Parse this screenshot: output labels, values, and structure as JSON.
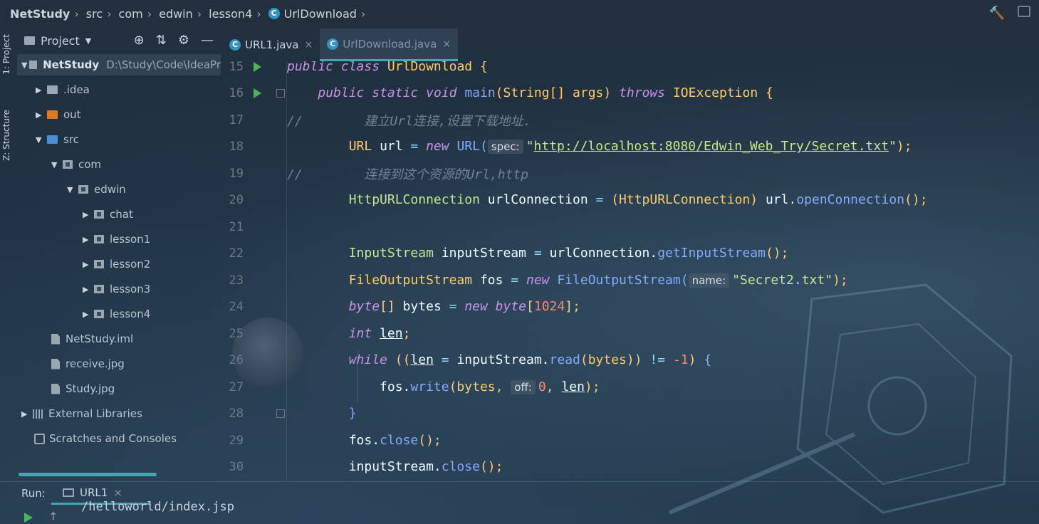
{
  "navbar": {
    "crumbs": [
      "NetStudy",
      "src",
      "com",
      "edwin",
      "lesson4",
      "UrlDownload"
    ],
    "class_icon": "C"
  },
  "sidebar_strip": {
    "project": "1: Project",
    "structure": "Z: Structure"
  },
  "project_panel": {
    "title": "Project",
    "root": {
      "name": "NetStudy",
      "path": "D:\\Study\\Code\\IdeaPr"
    },
    "items": [
      {
        "label": ".idea"
      },
      {
        "label": "out"
      },
      {
        "label": "src"
      },
      {
        "label": "com"
      },
      {
        "label": "edwin"
      },
      {
        "label": "chat"
      },
      {
        "label": "lesson1"
      },
      {
        "label": "lesson2"
      },
      {
        "label": "lesson3"
      },
      {
        "label": "lesson4"
      },
      {
        "label": "NetStudy.iml"
      },
      {
        "label": "receive.jpg"
      },
      {
        "label": "Study.jpg"
      },
      {
        "label": "External Libraries"
      },
      {
        "label": "Scratches and Consoles"
      }
    ]
  },
  "tabs": [
    {
      "label": "URL1.java",
      "close": "×"
    },
    {
      "label": "UrlDownload.java",
      "close": "×"
    }
  ],
  "editor": {
    "line_numbers": [
      "15",
      "16",
      "17",
      "18",
      "19",
      "20",
      "21",
      "22",
      "23",
      "24",
      "25",
      "26",
      "27",
      "28",
      "29",
      "30"
    ],
    "line15": {
      "a": "public",
      "b": "class",
      "c": "UrlDownload",
      "d": "{"
    },
    "line16": {
      "a": "public",
      "b": "static",
      "c": "void",
      "d": "main",
      "e": "(String[] args)",
      "f": "throws",
      "g": "IOException",
      "h": "{"
    },
    "line17": {
      "slashes": "//",
      "comment": "建立Url连接,设置下载地址."
    },
    "line18": {
      "a": "URL",
      "b": "url",
      "c": "=",
      "d": "new",
      "e": "URL(",
      "hint": "spec:",
      "q1": "\"",
      "url": "http://localhost:8080/Edwin_Web_Try/Secret.txt",
      "q2": "\"",
      "end": ");"
    },
    "line19": {
      "slashes": "//",
      "comment": "连接到这个资源的Url,http"
    },
    "line20": {
      "a": "HttpURLConnection",
      "b": "urlConnection",
      "c": "=",
      "d": "(HttpURLConnection)",
      "e": "url.",
      "f": "openConnection",
      "g": "();"
    },
    "line22": {
      "a": "InputStream",
      "b": "inputStream",
      "c": "=",
      "d": "urlConnection.",
      "e": "getInputStream",
      "f": "();"
    },
    "line23": {
      "a": "FileOutputStream",
      "b": "fos",
      "c": "=",
      "d": "new",
      "e": "FileOutputStream(",
      "hint": "name:",
      "s": "\"Secret2.txt\"",
      "end": ");"
    },
    "line24": {
      "a": "byte",
      "b": "[]",
      "c": "bytes",
      "d": "=",
      "e": "new",
      "f": "byte",
      "g": "[",
      "n": "1024",
      "h": "];"
    },
    "line25": {
      "a": "int",
      "b": "len",
      "c": ";"
    },
    "line26": {
      "a": "while",
      "b": "((",
      "c": "len",
      "d": "=",
      "e": "inputStream.",
      "f": "read",
      "g": "(bytes))",
      "h": "!=",
      "i": "-1",
      "j": ")",
      "k": "{"
    },
    "line27": {
      "a": "fos.",
      "b": "write",
      "c": "(bytes,",
      "hint": "off:",
      "n": "0",
      "d": ",",
      "e": "len",
      "f": ");"
    },
    "line28": {
      "a": "}"
    },
    "line29": {
      "a": "fos.",
      "b": "close",
      "c": "();"
    },
    "line30": {
      "a": "inputStream.",
      "b": "close",
      "c": "();"
    }
  },
  "run_panel": {
    "label": "Run:",
    "tab": "URL1",
    "close": "×",
    "output": "/helloworld/index.jsp"
  }
}
